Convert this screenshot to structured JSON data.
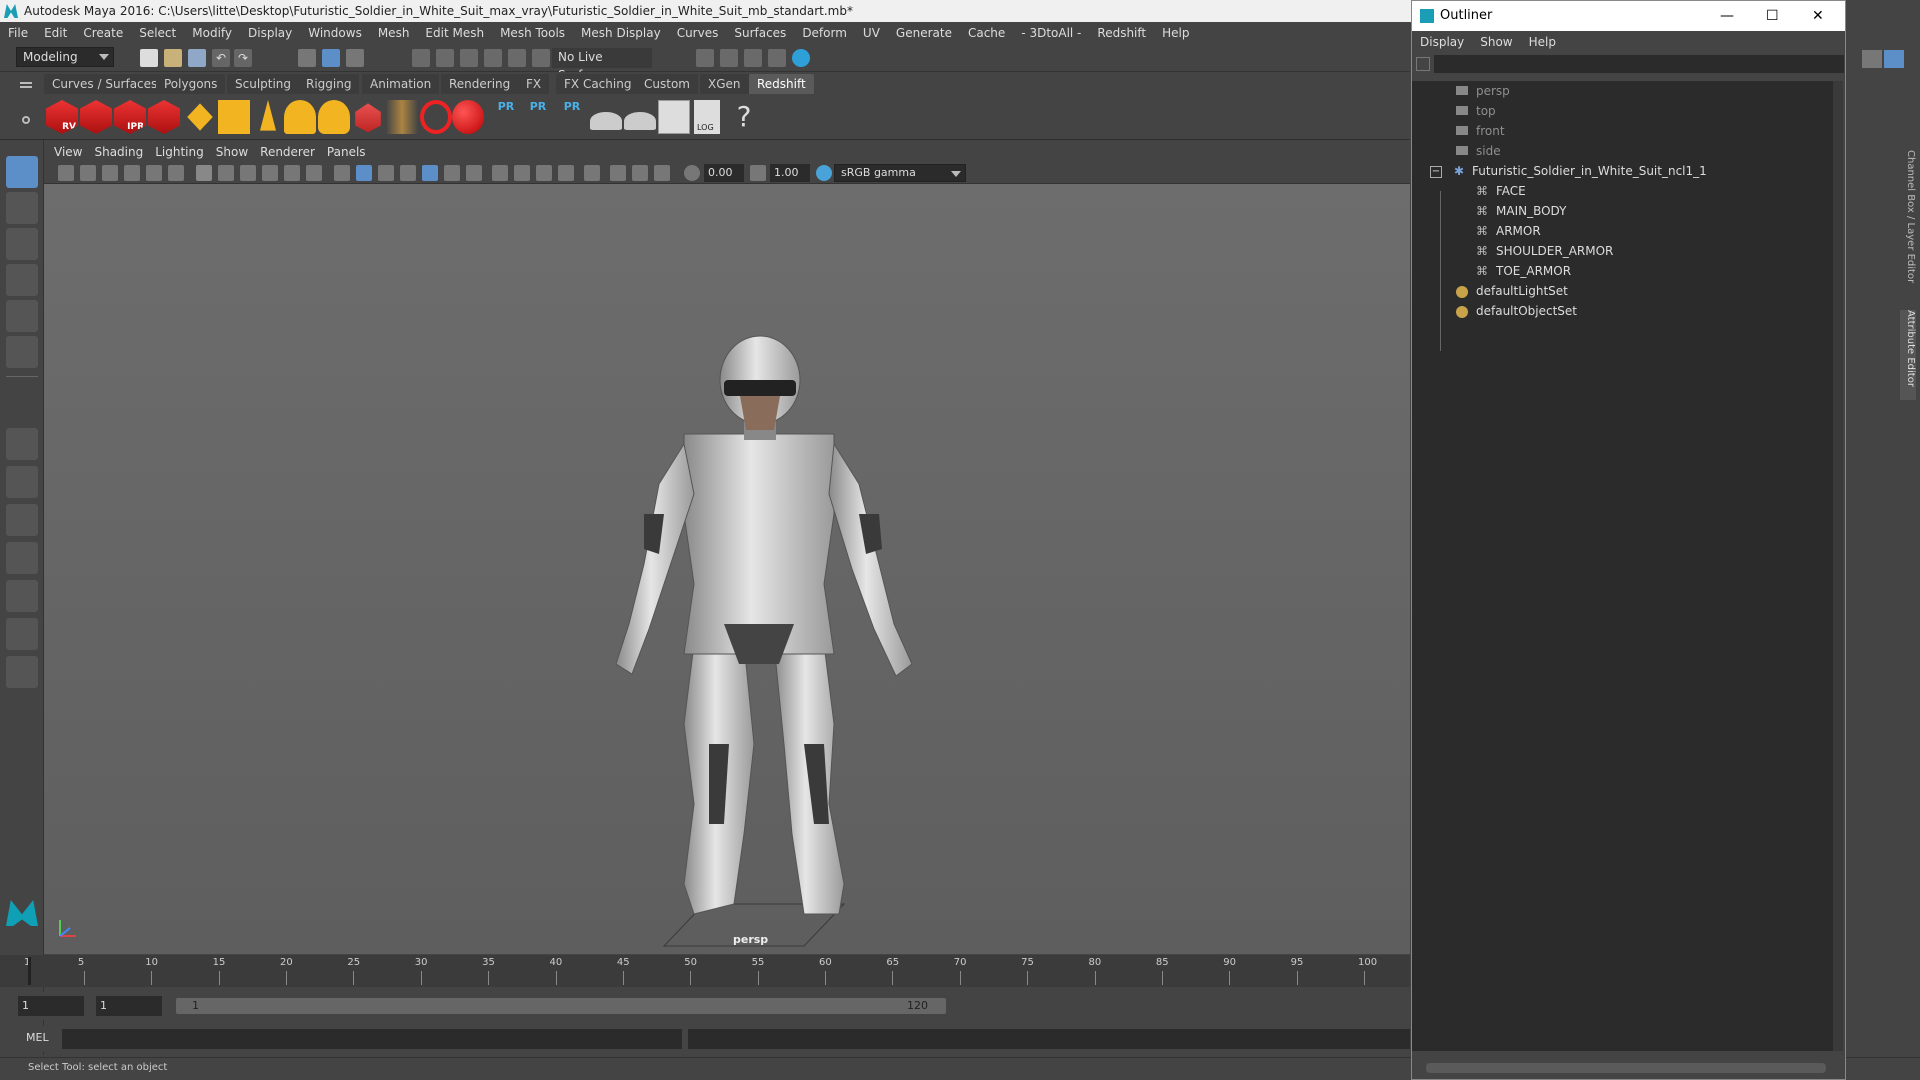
{
  "window": {
    "title": "Autodesk Maya 2016: C:\\Users\\litte\\Desktop\\Futuristic_Soldier_in_White_Suit_max_vray\\Futuristic_Soldier_in_White_Suit_mb_standart.mb*"
  },
  "menubar": [
    "File",
    "Edit",
    "Create",
    "Select",
    "Modify",
    "Display",
    "Windows",
    "Mesh",
    "Edit Mesh",
    "Mesh Tools",
    "Mesh Display",
    "Curves",
    "Surfaces",
    "Deform",
    "UV",
    "Generate",
    "Cache",
    "- 3DtoAll -",
    "Redshift",
    "Help"
  ],
  "statusline": {
    "mode": "Modeling",
    "live_surface": "No Live Surface"
  },
  "shelf_tabs": [
    "Curves / Surfaces",
    "Polygons",
    "Sculpting",
    "Rigging",
    "Animation",
    "Rendering",
    "FX",
    "FX Caching",
    "Custom",
    "XGen",
    "Redshift"
  ],
  "shelf_active": "Redshift",
  "shelf_icon_labels": {
    "rv": "RV",
    "ipr": "IPR",
    "pr": "PR",
    "log": "LOG"
  },
  "panel_menu": [
    "View",
    "Shading",
    "Lighting",
    "Show",
    "Renderer",
    "Panels"
  ],
  "panel_toolbar": {
    "exposure": "0.00",
    "gamma": "1.00",
    "color_space": "sRGB gamma"
  },
  "viewport": {
    "camera_label": "persp"
  },
  "timeline": {
    "ticks": [
      "1",
      "5",
      "10",
      "15",
      "20",
      "25",
      "30",
      "35",
      "40",
      "45",
      "50",
      "55",
      "60",
      "65",
      "70",
      "75",
      "80",
      "85",
      "90",
      "95",
      "100"
    ]
  },
  "range": {
    "start": "1",
    "current": "1",
    "range_start": "1",
    "range_end": "120"
  },
  "cmdline": {
    "lang": "MEL"
  },
  "helpline": {
    "text": "Select Tool: select an object"
  },
  "outliner": {
    "title": "Outliner",
    "menu": [
      "Display",
      "Show",
      "Help"
    ],
    "items": [
      {
        "label": "persp",
        "type": "camera",
        "dim": true
      },
      {
        "label": "top",
        "type": "camera",
        "dim": true
      },
      {
        "label": "front",
        "type": "camera",
        "dim": true
      },
      {
        "label": "side",
        "type": "camera",
        "dim": true
      },
      {
        "label": "Futuristic_Soldier_in_White_Suit_ncl1_1",
        "type": "group"
      },
      {
        "label": "FACE",
        "type": "mesh"
      },
      {
        "label": "MAIN_BODY",
        "type": "mesh"
      },
      {
        "label": "ARMOR",
        "type": "mesh"
      },
      {
        "label": "SHOULDER_ARMOR",
        "type": "mesh"
      },
      {
        "label": "TOE_ARMOR",
        "type": "mesh"
      },
      {
        "label": "defaultLightSet",
        "type": "set"
      },
      {
        "label": "defaultObjectSet",
        "type": "set"
      }
    ]
  },
  "side_tabs": [
    "Channel Box / Layer Editor",
    "Attribute Editor"
  ]
}
